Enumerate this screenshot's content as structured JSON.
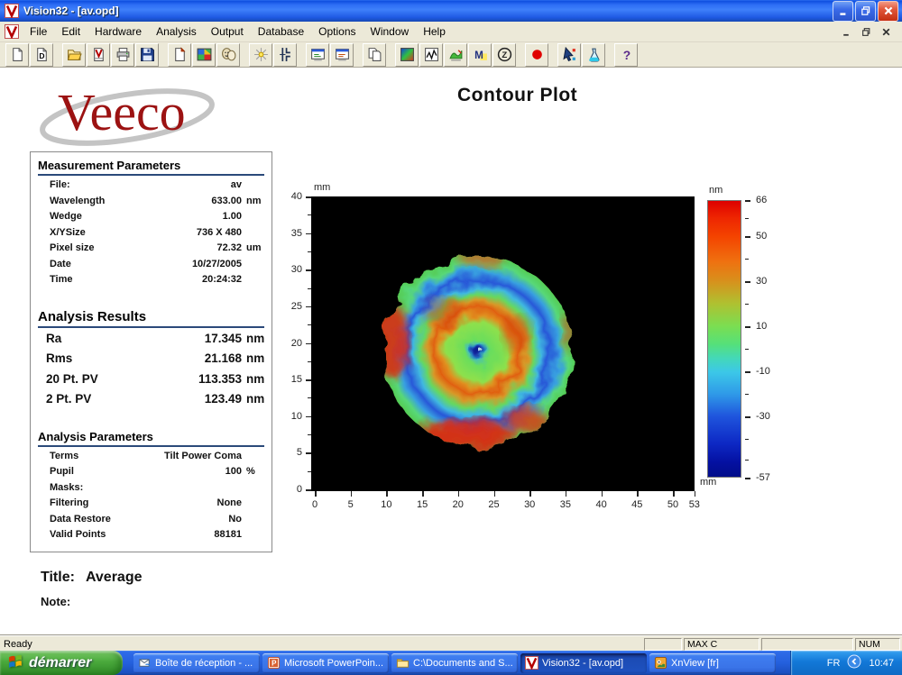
{
  "colors": {
    "titlebar_blue": "#1f5ae4",
    "taskbar_blue": "#2460dd",
    "start_green": "#3f9e33",
    "veeco_red": "#9c1212",
    "header_underline": "#2b4a7a",
    "plot_background": "#000000"
  },
  "window": {
    "title": "Vision32 - [av.opd]",
    "controls": [
      "minimize",
      "restore",
      "close"
    ],
    "mdi_controls": [
      "minimize",
      "restore",
      "close"
    ]
  },
  "menu_bar": {
    "items": [
      "File",
      "Edit",
      "Hardware",
      "Analysis",
      "Output",
      "Database",
      "Options",
      "Window",
      "Help"
    ]
  },
  "toolbar": {
    "groups": [
      [
        "new-doc-icon",
        "new-database-doc-icon"
      ],
      [
        "open-folder-icon",
        "open-v-doc-icon",
        "print-icon",
        "save-icon"
      ],
      [
        "new-page-icon",
        "color-map-icon",
        "masks-icon"
      ],
      [
        "light-source-icon",
        "caliper-icon"
      ],
      [
        "screen-window-icon",
        "screen-window2-icon"
      ],
      [
        "copy-pages-icon"
      ],
      [
        "gradient-fill-icon",
        "line-plot-icon",
        "surface-3d-icon",
        "m-tool-icon",
        "z-circle-icon"
      ],
      [
        "record-icon"
      ],
      [
        "pointer-tool-icon",
        "flask-icon"
      ],
      [
        "help-icon"
      ]
    ]
  },
  "document": {
    "brand": "Veeco",
    "page_title": "Contour Plot",
    "measurement_parameters": {
      "title": "Measurement Parameters",
      "rows": [
        {
          "label": "File:",
          "value": "av",
          "unit": ""
        },
        {
          "label": "Wavelength",
          "value": "633.00",
          "unit": "nm"
        },
        {
          "label": "Wedge",
          "value": "1.00",
          "unit": ""
        },
        {
          "label": "X/YSize",
          "value": "736 X 480",
          "unit": ""
        },
        {
          "label": "Pixel size",
          "value": "72.32",
          "unit": "um"
        },
        {
          "label": "Date",
          "value": "10/27/2005",
          "unit": ""
        },
        {
          "label": "Time",
          "value": "20:24:32",
          "unit": ""
        }
      ]
    },
    "analysis_results": {
      "title": "Analysis Results",
      "rows": [
        {
          "label": "Ra",
          "value": "17.345",
          "unit": "nm"
        },
        {
          "label": "Rms",
          "value": "21.168",
          "unit": "nm"
        },
        {
          "label": "20 Pt. PV",
          "value": "113.353",
          "unit": "nm"
        },
        {
          "label": "2 Pt. PV",
          "value": "123.49",
          "unit": "nm"
        }
      ]
    },
    "analysis_parameters": {
      "title": "Analysis Parameters",
      "rows": [
        {
          "label": "Terms",
          "value": "Tilt Power Coma",
          "unit": ""
        },
        {
          "label": "Pupil",
          "value": "100",
          "unit": "%"
        },
        {
          "label": "Masks:",
          "value": "",
          "unit": ""
        },
        {
          "label": "Filtering",
          "value": "None",
          "unit": ""
        },
        {
          "label": "Data Restore",
          "value": "No",
          "unit": ""
        },
        {
          "label": "Valid Points",
          "value": "88181",
          "unit": ""
        }
      ]
    },
    "title_line": {
      "label": "Title:",
      "value": "Average"
    },
    "note_line": {
      "label": "Note:",
      "value": ""
    }
  },
  "plot": {
    "y_unit_top": "mm",
    "x_unit_right": "mm",
    "x_ticks": [
      0,
      5,
      10,
      15,
      20,
      25,
      30,
      35,
      40,
      45,
      50,
      53
    ],
    "y_ticks": [
      0,
      5,
      10,
      15,
      20,
      25,
      30,
      35,
      40
    ]
  },
  "colorbar": {
    "unit": "nm",
    "ticks": [
      66,
      50,
      30,
      10,
      -10,
      -30,
      -57
    ],
    "minor_ticks": [
      58,
      40,
      20,
      0,
      -20,
      -40,
      -49
    ]
  },
  "status_bar": {
    "ready": "Ready",
    "cells": [
      "",
      "MAX C",
      "",
      "NUM"
    ]
  },
  "taskbar": {
    "start_label": "démarrer",
    "buttons": [
      {
        "icon": "outlook-icon",
        "label": "Boîte de réception - ...",
        "active": false
      },
      {
        "icon": "powerpoint-icon",
        "label": "Microsoft PowerPoin...",
        "active": false
      },
      {
        "icon": "folder-icon",
        "label": "C:\\Documents and S...",
        "active": false
      },
      {
        "icon": "vision32-icon",
        "label": "Vision32 - [av.opd]",
        "active": true
      },
      {
        "icon": "xnview-icon",
        "label": "XnView [fr]",
        "active": false
      }
    ],
    "tray": {
      "lang": "FR",
      "time": "10:47"
    }
  },
  "chart_data": {
    "type": "heatmap",
    "title": "Contour Plot",
    "x_unit": "mm",
    "y_unit": "mm",
    "z_unit": "nm",
    "xlim": [
      0,
      53
    ],
    "ylim": [
      0,
      40
    ],
    "zlim": [
      -57,
      66
    ],
    "x_ticks": [
      0,
      5,
      10,
      15,
      20,
      25,
      30,
      35,
      40,
      45,
      50,
      53
    ],
    "y_ticks": [
      0,
      5,
      10,
      15,
      20,
      25,
      30,
      35,
      40
    ],
    "colorbar_ticks": [
      66,
      50,
      30,
      10,
      -10,
      -30,
      -57
    ],
    "background": "black",
    "surface": {
      "shape": "circular-disc",
      "center_mm": [
        22.8,
        19.0
      ],
      "radius_mm": 13.2,
      "radial_profile_nm": [
        {
          "r_frac": 0.0,
          "z": -45
        },
        {
          "r_frac": 0.06,
          "z": -15
        },
        {
          "r_frac": 0.13,
          "z": 12
        },
        {
          "r_frac": 0.3,
          "z": 18
        },
        {
          "r_frac": 0.44,
          "z": 48
        },
        {
          "r_frac": 0.56,
          "z": 18
        },
        {
          "r_frac": 0.72,
          "z": -25
        },
        {
          "r_frac": 0.86,
          "z": -10
        },
        {
          "r_frac": 0.95,
          "z": 12
        },
        {
          "r_frac": 1.0,
          "z": 15
        }
      ],
      "hot_spots_nm": [
        {
          "angle_deg": 185,
          "r_frac": 0.92,
          "z": 62
        },
        {
          "angle_deg": 268,
          "r_frac": 0.88,
          "z": 62
        },
        {
          "angle_deg": 310,
          "r_frac": 0.88,
          "z": 55
        },
        {
          "angle_deg": 92,
          "r_frac": 0.97,
          "z": 48
        }
      ]
    }
  }
}
